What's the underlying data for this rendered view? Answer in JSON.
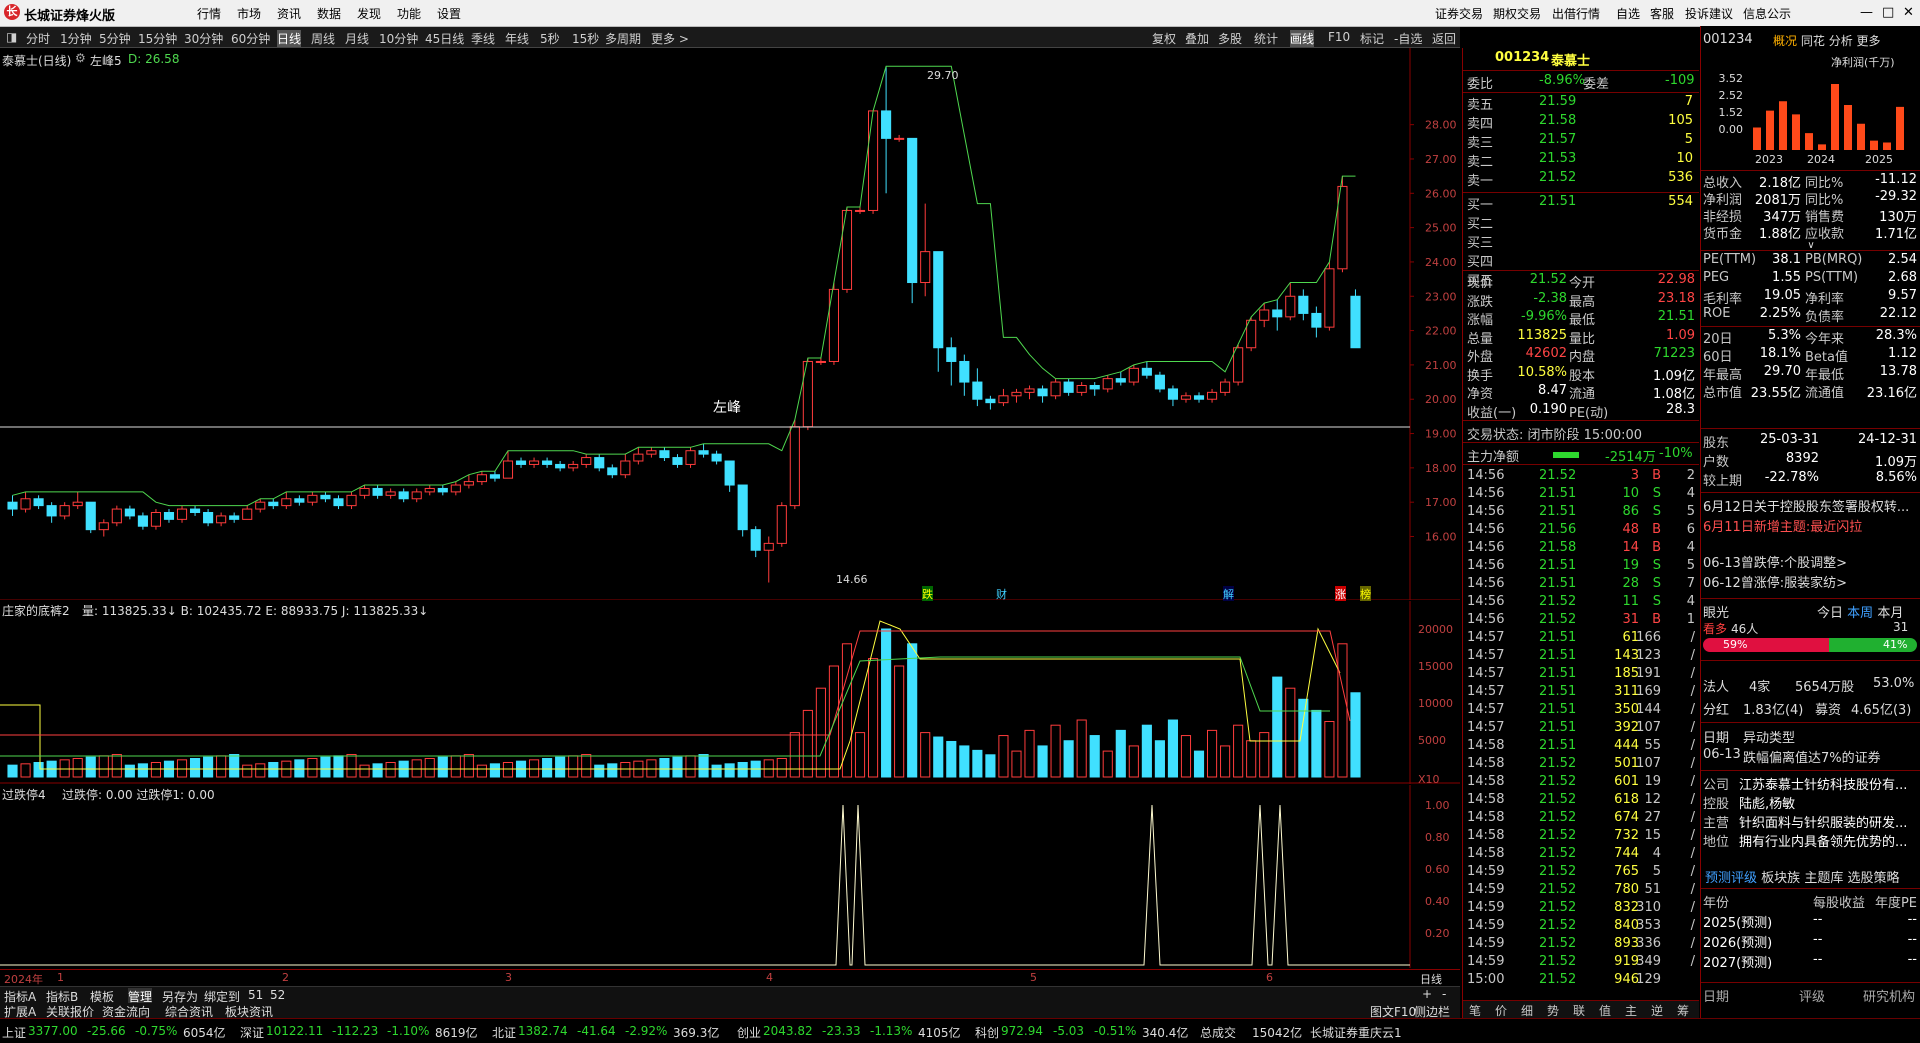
{
  "app": {
    "title": "长城证券烽火版"
  },
  "menu": [
    "行情",
    "市场",
    "资讯",
    "数据",
    "发现",
    "功能",
    "设置"
  ],
  "menu_right": [
    "证券交易",
    "期权交易",
    "出借行情",
    "自选",
    "客服",
    "投诉建议",
    "信息公示"
  ],
  "periods": [
    "分时",
    "1分钟",
    "5分钟",
    "15分钟",
    "30分钟",
    "60分钟",
    "日线",
    "周线",
    "月线",
    "10分钟",
    "45日线",
    "季线",
    "年线",
    "5秒",
    "15秒",
    "多周期",
    "更多 >"
  ],
  "active_period": "日线",
  "toolbar_right": [
    "复权",
    "叠加",
    "多股",
    "统计",
    "画线",
    "F10",
    "标记",
    "-自选",
    "返回"
  ],
  "chart": {
    "main_label": "泰慕士(日线)",
    "indicator_name": "左峰5",
    "indicator_value": "D: 26.58",
    "peak_text": "左峰",
    "high_label": "29.70",
    "low_label": "14.66",
    "y_ticks": [
      "28.00",
      "27.00",
      "26.00",
      "25.00",
      "24.00",
      "23.00",
      "22.00",
      "21.00",
      "20.00",
      "19.00",
      "18.00",
      "17.00",
      "16.00"
    ],
    "event_tags": [
      "跌",
      "财",
      "解",
      "涨",
      "榜"
    ],
    "sub1_label": "庄家的底裤2",
    "sub1_values": "量: 113825.33↓  B: 102435.72  E: 88933.75  J: 113825.33↓",
    "sub1_ticks": [
      "20000",
      "15000",
      "10000",
      "5000",
      "X10"
    ],
    "sub2_label": "过跌停4",
    "sub2_values": "过跌停: 0.00  过跌停1: 0.00",
    "sub2_ticks": [
      "1.00",
      "0.80",
      "0.60",
      "0.40",
      "0.20"
    ],
    "x_labels": [
      "2024年",
      "1",
      "2",
      "3",
      "4",
      "5",
      "6"
    ],
    "period_footer": "日线",
    "tabs": [
      "指标A",
      "指标B",
      "模板",
      "管理",
      "另存为",
      "绑定到",
      "51",
      "52"
    ],
    "bottom_tabs": [
      "扩展A",
      "关联报价",
      "资金流向",
      "综合资讯",
      "板块资讯"
    ]
  },
  "chart_data": {
    "type": "candlestick",
    "y_range": [
      14.5,
      30.0
    ],
    "candles": [
      [
        17.0,
        16.8,
        17.2,
        16.6
      ],
      [
        16.8,
        17.1,
        17.3,
        16.7
      ],
      [
        17.1,
        16.9,
        17.2,
        16.8
      ],
      [
        16.9,
        16.6,
        17.0,
        16.4
      ],
      [
        16.6,
        16.9,
        17.0,
        16.5
      ],
      [
        16.9,
        17.0,
        17.3,
        16.8
      ],
      [
        17.0,
        16.2,
        17.0,
        16.1
      ],
      [
        16.2,
        16.4,
        16.5,
        16.0
      ],
      [
        16.4,
        16.8,
        16.9,
        16.3
      ],
      [
        16.8,
        16.6,
        16.9,
        16.5
      ],
      [
        16.6,
        16.3,
        16.7,
        16.2
      ],
      [
        16.3,
        16.7,
        16.8,
        16.2
      ],
      [
        16.7,
        16.5,
        16.8,
        16.4
      ],
      [
        16.5,
        16.8,
        16.9,
        16.4
      ],
      [
        16.8,
        16.7,
        16.9,
        16.6
      ],
      [
        16.7,
        16.4,
        16.8,
        16.3
      ],
      [
        16.4,
        16.6,
        16.7,
        16.3
      ],
      [
        16.6,
        16.5,
        16.7,
        16.4
      ],
      [
        16.5,
        16.8,
        16.9,
        16.5
      ],
      [
        16.8,
        17.0,
        17.1,
        16.7
      ],
      [
        17.0,
        16.9,
        17.1,
        16.8
      ],
      [
        16.9,
        17.1,
        17.3,
        16.8
      ],
      [
        17.1,
        17.0,
        17.2,
        16.9
      ],
      [
        17.0,
        17.2,
        17.3,
        16.9
      ],
      [
        17.2,
        17.1,
        17.3,
        17.0
      ],
      [
        17.1,
        16.9,
        17.2,
        16.8
      ],
      [
        16.9,
        17.2,
        17.3,
        16.8
      ],
      [
        17.2,
        17.4,
        17.5,
        17.1
      ],
      [
        17.4,
        17.2,
        17.5,
        17.1
      ],
      [
        17.2,
        17.3,
        17.4,
        17.1
      ],
      [
        17.3,
        17.1,
        17.4,
        17.0
      ],
      [
        17.1,
        17.3,
        17.4,
        17.0
      ],
      [
        17.3,
        17.4,
        17.5,
        17.2
      ],
      [
        17.4,
        17.3,
        17.5,
        17.2
      ],
      [
        17.3,
        17.5,
        17.6,
        17.2
      ],
      [
        17.5,
        17.6,
        17.8,
        17.4
      ],
      [
        17.6,
        17.8,
        17.9,
        17.5
      ],
      [
        17.8,
        17.7,
        17.9,
        17.6
      ],
      [
        17.7,
        18.2,
        18.5,
        17.7
      ],
      [
        18.2,
        18.1,
        18.3,
        18.0
      ],
      [
        18.1,
        18.2,
        18.3,
        18.0
      ],
      [
        18.2,
        18.1,
        18.3,
        18.0
      ],
      [
        18.1,
        18.0,
        18.2,
        17.9
      ],
      [
        18.0,
        18.1,
        18.2,
        17.9
      ],
      [
        18.1,
        18.3,
        18.4,
        18.0
      ],
      [
        18.3,
        18.0,
        18.4,
        17.9
      ],
      [
        18.0,
        17.8,
        18.1,
        17.7
      ],
      [
        17.8,
        18.2,
        18.4,
        17.7
      ],
      [
        18.2,
        18.4,
        18.6,
        18.1
      ],
      [
        18.4,
        18.5,
        18.6,
        18.3
      ],
      [
        18.5,
        18.3,
        18.6,
        18.2
      ],
      [
        18.3,
        18.1,
        18.4,
        18.0
      ],
      [
        18.1,
        18.5,
        18.6,
        18.0
      ],
      [
        18.5,
        18.4,
        18.7,
        18.3
      ],
      [
        18.4,
        18.2,
        18.5,
        18.1
      ],
      [
        18.2,
        17.5,
        18.2,
        17.3
      ],
      [
        17.5,
        16.2,
        17.5,
        16.0
      ],
      [
        16.2,
        15.6,
        16.3,
        15.4
      ],
      [
        15.6,
        15.8,
        16.0,
        14.66
      ],
      [
        15.8,
        16.9,
        17.0,
        15.7
      ],
      [
        16.9,
        19.2,
        19.4,
        16.8
      ],
      [
        19.2,
        21.1,
        21.2,
        19.1
      ],
      [
        21.1,
        21.1,
        21.2,
        21.0
      ],
      [
        21.1,
        23.2,
        23.4,
        21.0
      ],
      [
        23.2,
        25.5,
        25.6,
        23.1
      ],
      [
        25.5,
        25.5,
        25.6,
        25.4
      ],
      [
        25.5,
        28.4,
        28.4,
        25.4
      ],
      [
        28.4,
        27.6,
        29.7,
        26.0
      ],
      [
        27.6,
        27.6,
        27.7,
        27.5
      ],
      [
        27.6,
        23.4,
        24.4,
        22.8
      ],
      [
        23.4,
        24.3,
        25.7,
        23.0
      ],
      [
        24.3,
        21.5,
        21.6,
        20.8
      ],
      [
        21.5,
        21.1,
        21.8,
        20.4
      ],
      [
        21.1,
        20.5,
        21.3,
        20.1
      ],
      [
        20.5,
        20.0,
        20.9,
        19.8
      ],
      [
        20.0,
        19.9,
        20.1,
        19.7
      ],
      [
        19.9,
        20.1,
        20.3,
        19.8
      ],
      [
        20.1,
        20.2,
        20.3,
        19.9
      ],
      [
        20.2,
        20.3,
        20.4,
        20.0
      ],
      [
        20.3,
        20.1,
        20.4,
        19.9
      ],
      [
        20.1,
        20.5,
        20.6,
        20.0
      ],
      [
        20.5,
        20.2,
        20.6,
        20.1
      ],
      [
        20.2,
        20.4,
        20.5,
        20.1
      ],
      [
        20.4,
        20.3,
        20.5,
        20.1
      ],
      [
        20.3,
        20.6,
        20.7,
        20.2
      ],
      [
        20.6,
        20.5,
        20.8,
        20.4
      ],
      [
        20.5,
        20.9,
        21.0,
        20.4
      ],
      [
        20.9,
        20.7,
        21.1,
        20.6
      ],
      [
        20.7,
        20.3,
        20.8,
        20.2
      ],
      [
        20.3,
        20.0,
        20.4,
        19.8
      ],
      [
        20.0,
        20.1,
        20.2,
        19.9
      ],
      [
        20.1,
        20.0,
        20.2,
        19.9
      ],
      [
        20.0,
        20.2,
        20.3,
        19.9
      ],
      [
        20.2,
        20.5,
        20.6,
        20.1
      ],
      [
        20.5,
        21.5,
        21.6,
        20.4
      ],
      [
        21.5,
        22.3,
        22.4,
        21.4
      ],
      [
        22.3,
        22.6,
        22.8,
        22.1
      ],
      [
        22.6,
        22.4,
        22.9,
        22.0
      ],
      [
        22.4,
        23.0,
        23.4,
        22.3
      ],
      [
        23.0,
        22.5,
        23.2,
        22.3
      ],
      [
        22.5,
        22.1,
        22.7,
        21.8
      ],
      [
        22.1,
        23.8,
        24.0,
        22.0
      ],
      [
        23.8,
        26.2,
        26.5,
        23.7
      ],
      [
        23.0,
        21.5,
        23.2,
        21.5
      ]
    ],
    "volume_max": 20000,
    "series": [
      {
        "name": "左峰5"
      },
      {
        "name": "量"
      },
      {
        "name": "过跌停"
      }
    ]
  },
  "quote": {
    "code": "001234",
    "name": "泰慕士",
    "weibi_label": "委比",
    "weibi": "-8.96%",
    "weicha_label": "委差",
    "weicha": "-109",
    "asks": [
      {
        "label": "卖五",
        "price": "21.59",
        "vol": "7"
      },
      {
        "label": "卖四",
        "price": "21.58",
        "vol": "105"
      },
      {
        "label": "卖三",
        "price": "21.57",
        "vol": "5"
      },
      {
        "label": "卖二",
        "price": "21.53",
        "vol": "10"
      },
      {
        "label": "卖一",
        "price": "21.52",
        "vol": "536"
      }
    ],
    "bids": [
      {
        "label": "买一",
        "price": "21.51",
        "vol": "554"
      },
      {
        "label": "买二",
        "price": "",
        "vol": ""
      },
      {
        "label": "买三",
        "price": "",
        "vol": ""
      },
      {
        "label": "买四",
        "price": "",
        "vol": ""
      },
      {
        "label": "买五",
        "price": "",
        "vol": ""
      }
    ],
    "stats": [
      {
        "l1": "现价",
        "v1": "21.52",
        "c1": "green",
        "l2": "今开",
        "v2": "22.98",
        "c2": "red"
      },
      {
        "l1": "涨跌",
        "v1": "-2.38",
        "c1": "green",
        "l2": "最高",
        "v2": "23.18",
        "c2": "red"
      },
      {
        "l1": "涨幅",
        "v1": "-9.96%",
        "c1": "green",
        "l2": "最低",
        "v2": "21.51",
        "c2": "green"
      },
      {
        "l1": "总量",
        "v1": "113825",
        "c1": "yellow",
        "l2": "量比",
        "v2": "1.09",
        "c2": "red"
      },
      {
        "l1": "外盘",
        "v1": "42602",
        "c1": "red",
        "l2": "内盘",
        "v2": "71223",
        "c2": "green"
      },
      {
        "l1": "换手",
        "v1": "10.58%",
        "c1": "yellow",
        "l2": "股本",
        "v2": "1.09亿",
        "c2": "white"
      },
      {
        "l1": "净资",
        "v1": "8.47",
        "c1": "white",
        "l2": "流通",
        "v2": "1.08亿",
        "c2": "white"
      },
      {
        "l1": "收益(一)",
        "v1": "0.190",
        "c1": "white",
        "l2": "PE(动)",
        "v2": "28.3",
        "c2": "white"
      }
    ],
    "trade_state": "交易状态: 闭市阶段 15:00:00",
    "main_flow_label": "主力净额",
    "main_flow_value": "-2514万",
    "main_flow_pct": "-10%",
    "ticks": [
      [
        "14:56",
        "21.52",
        "3",
        "B",
        "2"
      ],
      [
        "14:56",
        "21.51",
        "10",
        "S",
        "4"
      ],
      [
        "14:56",
        "21.51",
        "86",
        "S",
        "5"
      ],
      [
        "14:56",
        "21.56",
        "48",
        "B",
        "6"
      ],
      [
        "14:56",
        "21.58",
        "14",
        "B",
        "4"
      ],
      [
        "14:56",
        "21.51",
        "19",
        "S",
        "5"
      ],
      [
        "14:56",
        "21.51",
        "28",
        "S",
        "7"
      ],
      [
        "14:56",
        "21.52",
        "11",
        "S",
        "4"
      ],
      [
        "14:56",
        "21.52",
        "31",
        "B",
        "1"
      ],
      [
        "14:57",
        "21.51",
        "61",
        "166",
        "/"
      ],
      [
        "14:57",
        "21.51",
        "143",
        "123",
        "/"
      ],
      [
        "14:57",
        "21.51",
        "185",
        "191",
        "/"
      ],
      [
        "14:57",
        "21.51",
        "311",
        "169",
        "/"
      ],
      [
        "14:57",
        "21.51",
        "350",
        "144",
        "/"
      ],
      [
        "14:57",
        "21.51",
        "392",
        "107",
        "/"
      ],
      [
        "14:58",
        "21.51",
        "444",
        "55",
        "/"
      ],
      [
        "14:58",
        "21.52",
        "501",
        "107",
        "/"
      ],
      [
        "14:58",
        "21.52",
        "601",
        "19",
        "/"
      ],
      [
        "14:58",
        "21.52",
        "618",
        "12",
        "/"
      ],
      [
        "14:58",
        "21.52",
        "674",
        "27",
        "/"
      ],
      [
        "14:58",
        "21.52",
        "732",
        "15",
        "/"
      ],
      [
        "14:58",
        "21.52",
        "744",
        "4",
        "/"
      ],
      [
        "14:59",
        "21.52",
        "765",
        "5",
        "/"
      ],
      [
        "14:59",
        "21.52",
        "780",
        "51",
        "/"
      ],
      [
        "14:59",
        "21.52",
        "832",
        "310",
        "/"
      ],
      [
        "14:59",
        "21.52",
        "840",
        "353",
        "/"
      ],
      [
        "14:59",
        "21.52",
        "893",
        "336",
        "/"
      ],
      [
        "14:59",
        "21.52",
        "919",
        "349",
        "/"
      ],
      [
        "15:00",
        "21.52",
        "946",
        "129",
        ""
      ]
    ],
    "bottom_tabs": [
      "笔",
      "价",
      "细",
      "势",
      "联",
      "值",
      "主",
      "逆",
      "筹"
    ]
  },
  "fund": {
    "code": "001234",
    "tabs": [
      "概况",
      "同花",
      "分析",
      "更多"
    ],
    "chart_title": "净利润(千万)",
    "bar_ticks": [
      "3.52",
      "2.52",
      "1.52",
      "0.00"
    ],
    "bar_years": [
      "2023",
      "2024",
      "2025"
    ],
    "bar_values": [
      1.2,
      2.1,
      2.6,
      1.9,
      0.9,
      0.3,
      3.52,
      2.4,
      1.4,
      0.5,
      0.4,
      2.3
    ],
    "rows1": [
      [
        "总收入",
        "2.18亿",
        "同比%",
        "-11.12"
      ],
      [
        "净利润",
        "2081万",
        "同比%",
        "-29.32"
      ],
      [
        "非经损",
        "347万",
        "销售费",
        "130万"
      ],
      [
        "货币金",
        "1.88亿",
        "应收款",
        "1.71亿"
      ]
    ],
    "rows2": [
      [
        "PE(TTM)",
        "38.1",
        "PB(MRQ)",
        "2.54"
      ],
      [
        "PEG",
        "1.55",
        "PS(TTM)",
        "2.68"
      ],
      [
        "毛利率",
        "19.05",
        "净利率",
        "9.57"
      ],
      [
        "ROE",
        "2.25%",
        "负债率",
        "22.12"
      ]
    ],
    "rows3": [
      [
        "20日",
        "5.3%",
        "今年来",
        "28.3%"
      ],
      [
        "60日",
        "18.1%",
        "Beta值",
        "1.12"
      ],
      [
        "年最高",
        "29.70",
        "年最低",
        "13.78"
      ],
      [
        "总市值",
        "23.55亿",
        "流通值",
        "23.16亿"
      ]
    ],
    "holders": [
      [
        "股东",
        "25-03-31",
        "24-12-31"
      ],
      [
        "户数",
        "8392",
        "1.09万"
      ],
      [
        "较上期",
        "-22.78%",
        "8.56%"
      ]
    ],
    "news": [
      "6月12日关于控股股东签署股权转...",
      "6月11日新增主题:最近闪拉",
      "06-13曾跌停:个股调整>",
      "06-12曾涨停:服装家纺>"
    ],
    "eye_label": "眼光",
    "eye_tabs": [
      "今日",
      "本周",
      "本月"
    ],
    "bull_label": "看多",
    "bull_count": "46人",
    "bull_pct": "59%",
    "bear_pct": "41%",
    "bear_count": "31",
    "legal_label": "法人",
    "legal_value": "4家",
    "legal_shares": "5654万股",
    "legal_pct": "53.0%",
    "div_label": "分红",
    "div_value": "1.83亿(4)",
    "raise_label": "募资",
    "raise_value": "4.65亿(3)",
    "anomaly_date_label": "日期",
    "anomaly_type_label": "异动类型",
    "anomaly_date": "06-13",
    "anomaly_text": "跌幅偏离值达7%的证券",
    "company_rows": [
      [
        "公司",
        "江苏泰慕士针纺科技股份有..."
      ],
      [
        "控股",
        "陆彪,杨敏"
      ],
      [
        "主营",
        "针织面料与针织服装的研发..."
      ],
      [
        "地位",
        "拥有行业内具备领先优势的..."
      ]
    ],
    "link_tabs": [
      "预测评级",
      "板块族",
      "主题库",
      "选股策略"
    ],
    "forecast_head": [
      "年份",
      "每股收益",
      "年度PE"
    ],
    "forecast_rows": [
      [
        "2025(预测)",
        "--",
        "--"
      ],
      [
        "2026(预测)",
        "--",
        "--"
      ],
      [
        "2027(预测)",
        "--",
        "--"
      ]
    ],
    "rating_head": [
      "日期",
      "评级",
      "研究机构"
    ]
  },
  "status": {
    "items": [
      {
        "name": "上证",
        "val": "3377.00",
        "chg": "-25.66",
        "pct": "-0.75%",
        "amt": "6054亿"
      },
      {
        "name": "深证",
        "val": "10122.11",
        "chg": "-112.23",
        "pct": "-1.10%",
        "amt": "8619亿"
      },
      {
        "name": "北证",
        "val": "1382.74",
        "chg": "-41.64",
        "pct": "-2.92%",
        "amt": "369.3亿"
      },
      {
        "name": "创业",
        "val": "2043.82",
        "chg": "-23.33",
        "pct": "-1.13%",
        "amt": "4105亿"
      },
      {
        "name": "科创",
        "val": "972.94",
        "chg": "-5.03",
        "pct": "-0.51%",
        "amt": "340.4亿"
      }
    ],
    "total_label": "总成交",
    "total": "15042亿",
    "broker": "长城证券重庆云1",
    "f10": "图文F10",
    "sidebar": "侧边栏"
  }
}
